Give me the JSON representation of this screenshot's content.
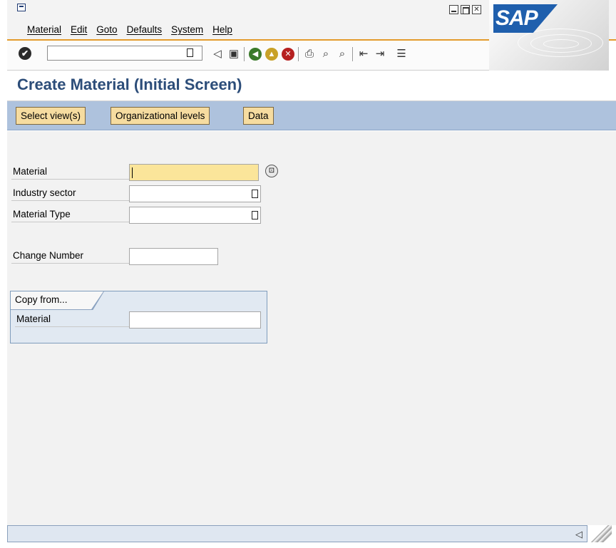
{
  "menu": {
    "items": [
      "Material",
      "Edit",
      "Goto",
      "Defaults",
      "System",
      "Help"
    ]
  },
  "logo": {
    "text": "SAP",
    "color": "#1f5fad"
  },
  "toolbar": {
    "command_value": "",
    "icons": [
      "back-icon",
      "save-icon",
      "green-back-icon",
      "exit-icon",
      "cancel-icon",
      "print-icon",
      "find-icon",
      "find-next-icon",
      "first-page-icon",
      "last-page-icon",
      "layout-menu-icon"
    ]
  },
  "page": {
    "title": "Create Material (Initial Screen)"
  },
  "app_toolbar": {
    "select_views": "Select view(s)",
    "org_levels": "Organizational levels",
    "data": "Data"
  },
  "form": {
    "material_label": "Material",
    "material_value": "",
    "industry_label": "Industry sector",
    "industry_value": "",
    "mattype_label": "Material Type",
    "mattype_value": "",
    "change_label": "Change Number",
    "change_value": ""
  },
  "copy_from": {
    "title": "Copy from...",
    "material_label": "Material",
    "material_value": ""
  },
  "colors": {
    "accent_orange": "#e39b2c",
    "title_blue": "#2c4d79",
    "app_toolbar_blue": "#aec2dd",
    "button_yellow": "#f6dca0",
    "required_field": "#fbe59a"
  }
}
